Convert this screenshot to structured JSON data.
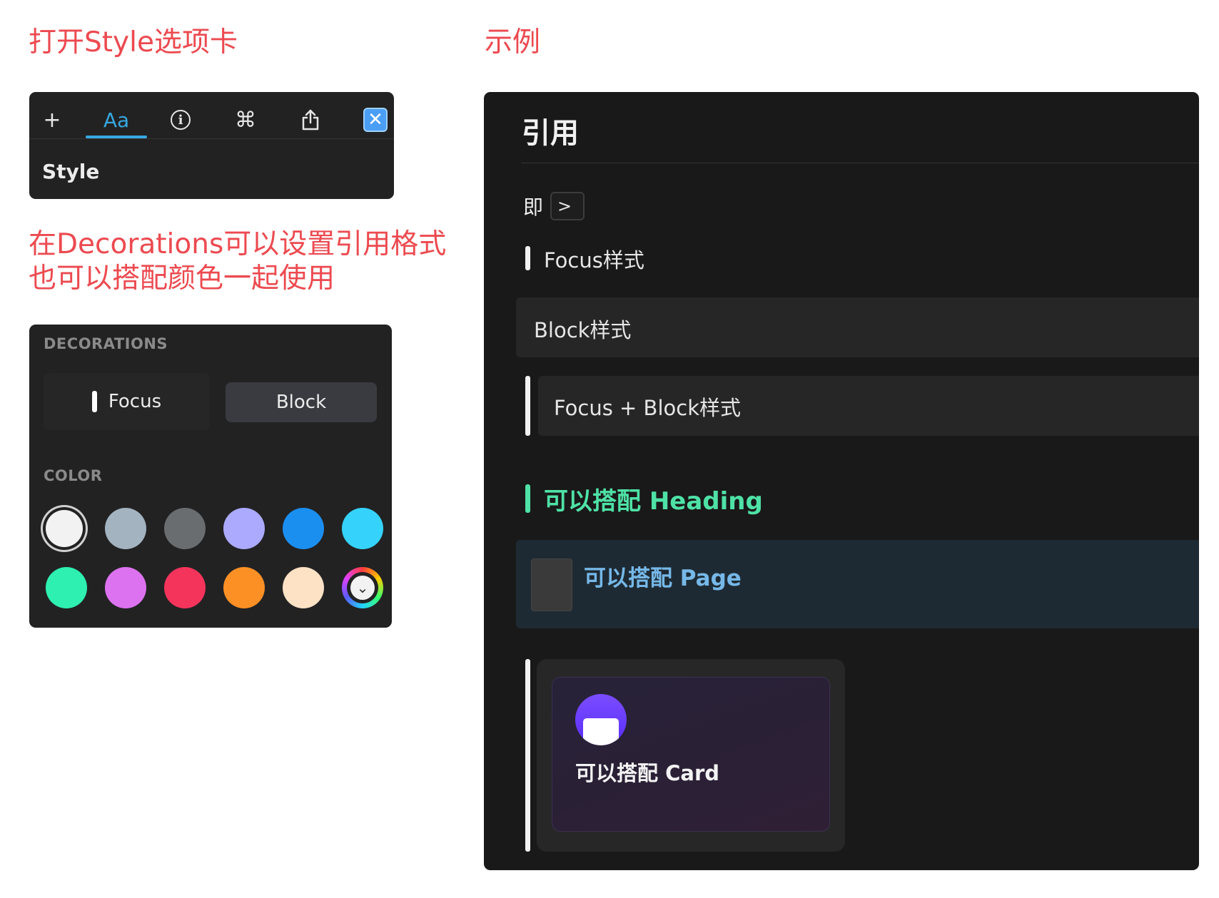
{
  "annotations": {
    "open_style": "打开Style选项卡",
    "example": "示例",
    "decorations_line1": "在Decorations可以设置引用格式",
    "decorations_line2": "也可以搭配颜色一起使用"
  },
  "toolbar": {
    "icons": [
      "plus-icon",
      "text-style-icon",
      "info-icon",
      "command-icon",
      "share-icon",
      "close-icon"
    ],
    "active_tab": "Aa",
    "plus": "+",
    "info": "i",
    "command": "⌘",
    "share": "⇪",
    "close": "✕",
    "accent_color": "#37a8e0",
    "section_label": "Style"
  },
  "decorations": {
    "header": "DECORATIONS",
    "buttons": [
      "Focus",
      "Block"
    ],
    "selected": "Block",
    "color_header": "COLOR",
    "colors": [
      "#f2f2f2",
      "#a3b3c0",
      "#6a6d70",
      "#abaaff",
      "#1b8ff0",
      "#35d3fb",
      "#2ef0b0",
      "#dd72f0",
      "#f5345c",
      "#fd9025",
      "#fde2c6"
    ],
    "selected_color": "#f2f2f2",
    "picker_icon": "chevron-down-icon",
    "picker_glyph": "⌄"
  },
  "example": {
    "title": "引用",
    "ji": "即",
    "kbd": ">",
    "focus": "Focus样式",
    "block": "Block样式",
    "focus_block": "Focus + Block样式",
    "heading": "可以搭配 Heading",
    "heading_color": "#4ee2a6",
    "page": "可以搭配 Page",
    "page_color": "#76b8e8",
    "card": "可以搭配 Card"
  }
}
